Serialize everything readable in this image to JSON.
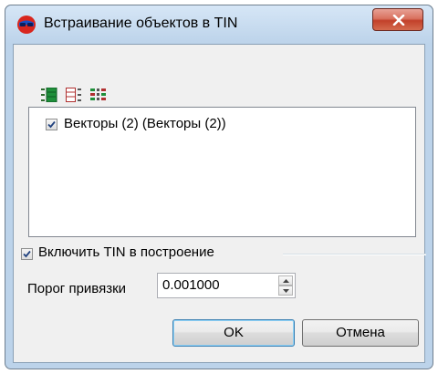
{
  "window": {
    "title": "Встраивание объектов в TIN",
    "close_icon": "close-icon",
    "accent": "#bcd3ea"
  },
  "toolbar": {
    "icons": [
      "select-all-icon",
      "deselect-all-icon",
      "invert-selection-icon"
    ]
  },
  "list": {
    "items": [
      {
        "label": "Векторы (2) (Векторы (2))",
        "checked": true
      }
    ]
  },
  "options": {
    "include_tin_label": "Включить TIN в построение",
    "include_tin_checked": true,
    "threshold_label": "Порог привязки",
    "threshold_value": "0.001000"
  },
  "buttons": {
    "ok_label": "OK",
    "cancel_label": "Отмена"
  }
}
